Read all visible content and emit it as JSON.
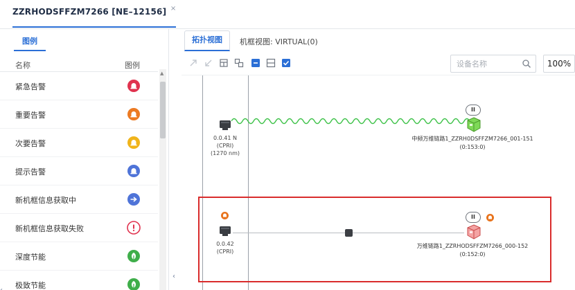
{
  "header": {
    "tab_title": "ZZRHODSFFZM7266 [NE–12156]",
    "close_glyph": "×"
  },
  "legend_panel": {
    "tab_label": "图例",
    "col_name": "名称",
    "col_icon": "图例",
    "items": [
      {
        "label": "紧急告警",
        "icon": "alarm-bell-icon",
        "color": "#e0334f"
      },
      {
        "label": "重要告警",
        "icon": "alarm-bell-icon",
        "color": "#ec7a22"
      },
      {
        "label": "次要告警",
        "icon": "alarm-bell-icon",
        "color": "#f0b41b"
      },
      {
        "label": "提示告警",
        "icon": "alarm-bell-icon",
        "color": "#4f74d8"
      },
      {
        "label": "新机框信息获取中",
        "icon": "arrow-right-icon",
        "color": "#4f74d8"
      },
      {
        "label": "新机框信息获取失败",
        "icon": "exclamation-icon",
        "color": "#e0334f"
      },
      {
        "label": "深度节能",
        "icon": "leaf-icon",
        "color": "#3fae4a"
      },
      {
        "label": "极致节能",
        "icon": "leaf-icon",
        "color": "#3fae4a"
      }
    ]
  },
  "topology": {
    "tab_label": "拓扑视图",
    "frame_tab": "机框视图: VIRTUAL(0)",
    "search_placeholder": "设备名称",
    "zoom_level": "100%",
    "toolbar_icons": [
      "expand-icon",
      "collapse-icon",
      "layout-icon",
      "group-icon",
      "fold-icon",
      "unfold-icon",
      "checkbox-icon"
    ],
    "links": [
      {
        "port_label_line1": "0.0.41 N",
        "port_label_line2": "(CPRI)",
        "port_label_line3": "(1270 nm)",
        "device_label": "中频万维链路1_ZZRH0DSFFZM7266_001-151",
        "device_sublabel": "(0:153:0)",
        "pause_glyph": "II",
        "link_style": "wavy",
        "link_color": "#3fc24a",
        "device_color": "#7ed957",
        "port_alarm": false
      },
      {
        "port_label_line1": "0.0.42",
        "port_label_line2": "(CPRI)",
        "device_label": "万维链路1_ZZRHODSFFZM7266_000-152",
        "device_sublabel": "(0:152:0)",
        "pause_glyph": "II",
        "link_style": "straight",
        "link_color": "#b8bcc2",
        "device_color": "#f08080",
        "port_alarm": true
      }
    ]
  },
  "colors": {
    "accent": "#2b6fd6",
    "highlight_border": "#d92b2b",
    "alarm_orange": "#e8731c"
  }
}
